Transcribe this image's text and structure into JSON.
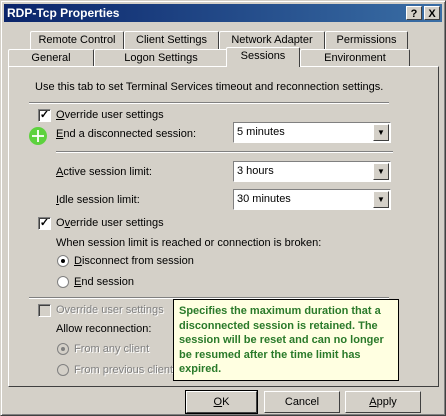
{
  "window": {
    "title": "RDP-Tcp Properties",
    "help_btn": "?",
    "close_btn": "X"
  },
  "tabs": {
    "row1": [
      "Remote Control",
      "Client Settings",
      "Network Adapter",
      "Permissions"
    ],
    "row2": [
      "General",
      "Logon Settings",
      "Sessions",
      "Environment"
    ],
    "active": "Sessions"
  },
  "panel": {
    "intro": "Use this tab to set Terminal Services timeout and reconnection settings.",
    "override1": "Override user settings",
    "end_disconnected_label": "End a disconnected session:",
    "end_disconnected_value": "5 minutes",
    "active_limit_label": "Active session limit:",
    "active_limit_value": "3 hours",
    "idle_limit_label": "Idle session limit:",
    "idle_limit_value": "30 minutes",
    "override2": "Override user settings",
    "when_limit_text": "When session limit is reached or connection is broken:",
    "disconnect_option": "Disconnect from session",
    "end_session_option": "End session",
    "override3": "Override user settings",
    "allow_reconnection": "Allow reconnection:",
    "from_any_client": "From any client",
    "from_previous_client": "From previous client"
  },
  "tooltip": {
    "text": "Specifies the maximum duration that a disconnected session is retained. The session will be reset and can no longer be resumed after the time limit has expired."
  },
  "buttons": {
    "ok": "OK",
    "cancel": "Cancel",
    "apply": "Apply"
  },
  "state": {
    "override1_checked": true,
    "override2_checked": true,
    "override3_checked": false,
    "disconnect_selected": true
  }
}
